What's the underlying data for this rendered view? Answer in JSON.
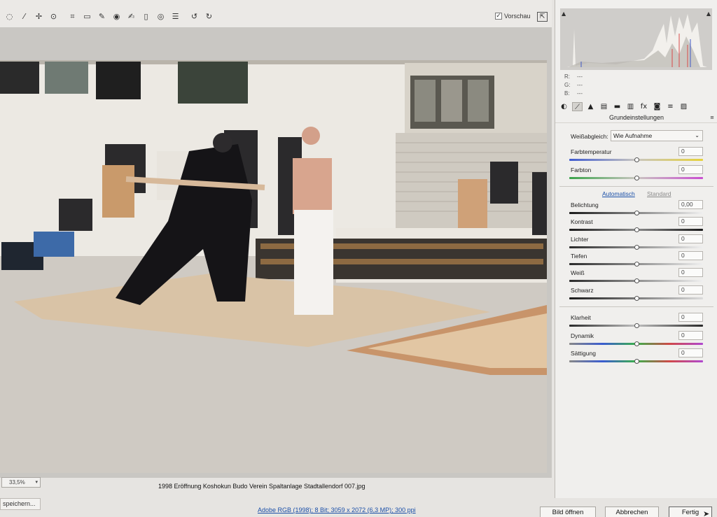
{
  "toolbar": {
    "tools": [
      {
        "icon": "zoom-icon",
        "glyph": "◌"
      },
      {
        "icon": "eyedropper-icon",
        "glyph": "⁄"
      },
      {
        "icon": "color-sampler-icon",
        "glyph": "✢"
      },
      {
        "icon": "target-adjust-icon",
        "glyph": "⊙"
      },
      {
        "icon": "crop-icon",
        "glyph": "⌗"
      },
      {
        "icon": "straighten-icon",
        "glyph": "▭"
      },
      {
        "icon": "spot-removal-icon",
        "glyph": "✎"
      },
      {
        "icon": "red-eye-icon",
        "glyph": "◉"
      },
      {
        "icon": "adjustment-brush-icon",
        "glyph": "✍"
      },
      {
        "icon": "graduated-filter-icon",
        "glyph": "▯"
      },
      {
        "icon": "radial-filter-icon",
        "glyph": "◎"
      },
      {
        "icon": "preferences-list-icon",
        "glyph": "☰"
      },
      {
        "icon": "rotate-left-icon",
        "glyph": "↺"
      },
      {
        "icon": "rotate-right-icon",
        "glyph": "↻"
      }
    ],
    "preview_label": "Vorschau",
    "preview_checked": true
  },
  "canvas": {
    "zoom": "33,5%",
    "filename": "1998 Eröffnung Koshokun Budo Verein Spaltanlage Stadtallendorf 007.jpg"
  },
  "histogram": {
    "rgb": [
      {
        "label": "R:",
        "value": "---"
      },
      {
        "label": "G:",
        "value": "---"
      },
      {
        "label": "B:",
        "value": "---"
      }
    ]
  },
  "panel": {
    "tabs": [
      {
        "icon": "basic-tab-icon",
        "glyph": "◐"
      },
      {
        "icon": "tone-curve-icon",
        "glyph": "⟋"
      },
      {
        "icon": "detail-icon",
        "glyph": "▲"
      },
      {
        "icon": "hsl-icon",
        "glyph": "▤"
      },
      {
        "icon": "split-toning-icon",
        "glyph": "▬"
      },
      {
        "icon": "lens-corrections-icon",
        "glyph": "▥"
      },
      {
        "icon": "effects-icon",
        "glyph": "fx"
      },
      {
        "icon": "camera-calibration-icon",
        "glyph": "◙"
      },
      {
        "icon": "presets-icon",
        "glyph": "≡"
      },
      {
        "icon": "snapshots-icon",
        "glyph": "▨"
      }
    ],
    "section_title": "Grundeinstellungen",
    "white_balance_label": "Weißabgleich:",
    "white_balance_value": "Wie Aufnahme",
    "link_auto": "Automatisch",
    "link_standard": "Standard",
    "controls": [
      {
        "label": "Farbtemperatur",
        "value": "0",
        "level": 0.5
      },
      {
        "label": "Farbton",
        "value": "0",
        "level": 0.5
      },
      {
        "label": "Belichtung",
        "value": "0,00",
        "level": 0.5
      },
      {
        "label": "Kontrast",
        "value": "0",
        "level": 0.5
      },
      {
        "label": "Lichter",
        "value": "0",
        "level": 0.5
      },
      {
        "label": "Tiefen",
        "value": "0",
        "level": 0.5
      },
      {
        "label": "Weiß",
        "value": "0",
        "level": 0.5
      },
      {
        "label": "Schwarz",
        "value": "0",
        "level": 0.5
      },
      {
        "label": "Klarheit",
        "value": "0",
        "level": 0.5
      },
      {
        "label": "Dynamik",
        "value": "0",
        "level": 0.5
      },
      {
        "label": "Sättigung",
        "value": "0",
        "level": 0.5
      }
    ]
  },
  "footer": {
    "save_label": "speichern...",
    "workflow_info": "Adobe RGB (1998); 8 Bit; 3059 x 2072 (6,3 MP); 300 ppi",
    "open_label": "Bild öffnen",
    "cancel_label": "Abbrechen",
    "done_label": "Fertig"
  }
}
